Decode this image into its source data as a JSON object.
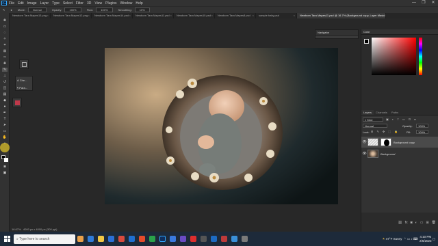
{
  "app": {
    "name": "Photoshop",
    "logo_text": "Ps"
  },
  "menu": [
    "File",
    "Edit",
    "Image",
    "Layer",
    "Type",
    "Select",
    "Filter",
    "3D",
    "View",
    "Plugins",
    "Window",
    "Help"
  ],
  "window_controls": [
    "—",
    "❐",
    "✕"
  ],
  "options_bar": {
    "mode_label": "Mode:",
    "mode_value": "Normal",
    "opacity_label": "Opacity:",
    "opacity_value": "100%",
    "flow_label": "Flow:",
    "flow_value": "100%",
    "smoothing_label": "Smoothing:",
    "smoothing_value": "10%"
  },
  "tabs": [
    {
      "label": "Newborn Tara Mapes13.png"
    },
    {
      "label": "Newborn Tara Mapes12.png"
    },
    {
      "label": "Newborn Tara Mapes14.psd"
    },
    {
      "label": "Newborn Tara Mapes11.psd"
    },
    {
      "label": "Newborn Tara Mapes10.psd"
    },
    {
      "label": "Newborn Tara Mapes8.psd"
    },
    {
      "label": "sample baby.psd"
    },
    {
      "label": "Newborn Tara Mapes11.psd @ 16.7% (Background copy, Layer Mask/8) *",
      "active": true
    }
  ],
  "mini_panel": {
    "item1": "Che...",
    "item2": "Para..."
  },
  "navigator": {
    "title": "Navigator"
  },
  "color_panel": {
    "title": "Color",
    "hue_color": "#ff0000"
  },
  "layers_panel": {
    "title": "Layers",
    "tabs": [
      "Layers",
      "Channels",
      "Paths"
    ],
    "kind_label": "Kind",
    "blend_mode": "Normal",
    "opacity_label": "Opacity:",
    "opacity_value": "100%",
    "lock_label": "Lock:",
    "fill_label": "Fill:",
    "fill_value": "100%",
    "layers": [
      {
        "name": "Background copy",
        "selected": true
      },
      {
        "name": "Background",
        "selected": false
      }
    ]
  },
  "status": {
    "zoom": "16.67%",
    "doc": "4000 px x 4000 px (300 ppi)"
  },
  "taskbar": {
    "search_placeholder": "Type here to search",
    "weather": "47°F  Sunny",
    "time": "4:10 PM",
    "date": "2/6/2023"
  }
}
